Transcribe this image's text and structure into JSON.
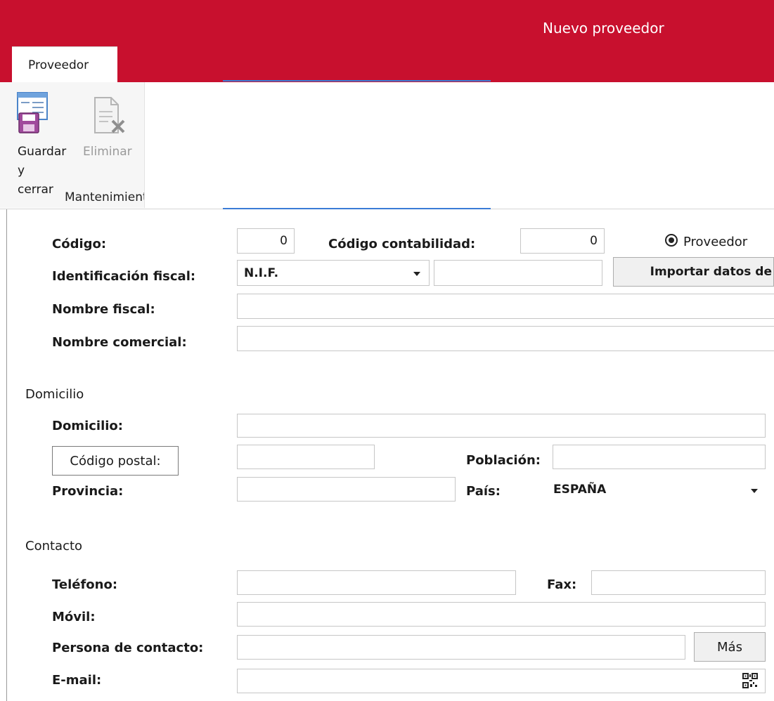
{
  "window": {
    "title": "Nuevo proveedor"
  },
  "ribbon": {
    "tab_label": "Proveedor",
    "save_close_line1": "Guardar",
    "save_close_line2": "y cerrar",
    "delete_label": "Eliminar",
    "group_label": "Mantenimiento"
  },
  "form": {
    "codigo_label": "Código:",
    "codigo_value": "0",
    "codigo_contabilidad_label": "Código contabilidad:",
    "codigo_contabilidad_value": "0",
    "radio_proveedor_label": "Proveedor",
    "id_fiscal_label": "Identificación fiscal:",
    "id_fiscal_type": "N.I.F.",
    "id_fiscal_value": "",
    "importar_button": "Importar datos de",
    "nombre_fiscal_label": "Nombre fiscal:",
    "nombre_fiscal_value": "",
    "nombre_comercial_label": "Nombre comercial:",
    "nombre_comercial_value": ""
  },
  "domicilio": {
    "section_title": "Domicilio",
    "domicilio_label": "Domicilio:",
    "domicilio_value": "",
    "codigo_postal_button": "Código postal:",
    "codigo_postal_value": "",
    "poblacion_label": "Población:",
    "poblacion_value": "",
    "provincia_label": "Provincia:",
    "provincia_value": "",
    "pais_label": "País:",
    "pais_value": "ESPAÑA"
  },
  "contacto": {
    "section_title": "Contacto",
    "telefono_label": "Teléfono:",
    "telefono_value": "",
    "fax_label": "Fax:",
    "fax_value": "",
    "movil_label": "Móvil:",
    "movil_value": "",
    "persona_label": "Persona de contacto:",
    "persona_value": "",
    "mas_button": "Más",
    "email_label": "E-mail:",
    "email_value": "",
    "qr_icon": "qr-code-icon"
  },
  "colors": {
    "accent": "#c8102e",
    "ribbon_line": "#3b7bd6"
  }
}
